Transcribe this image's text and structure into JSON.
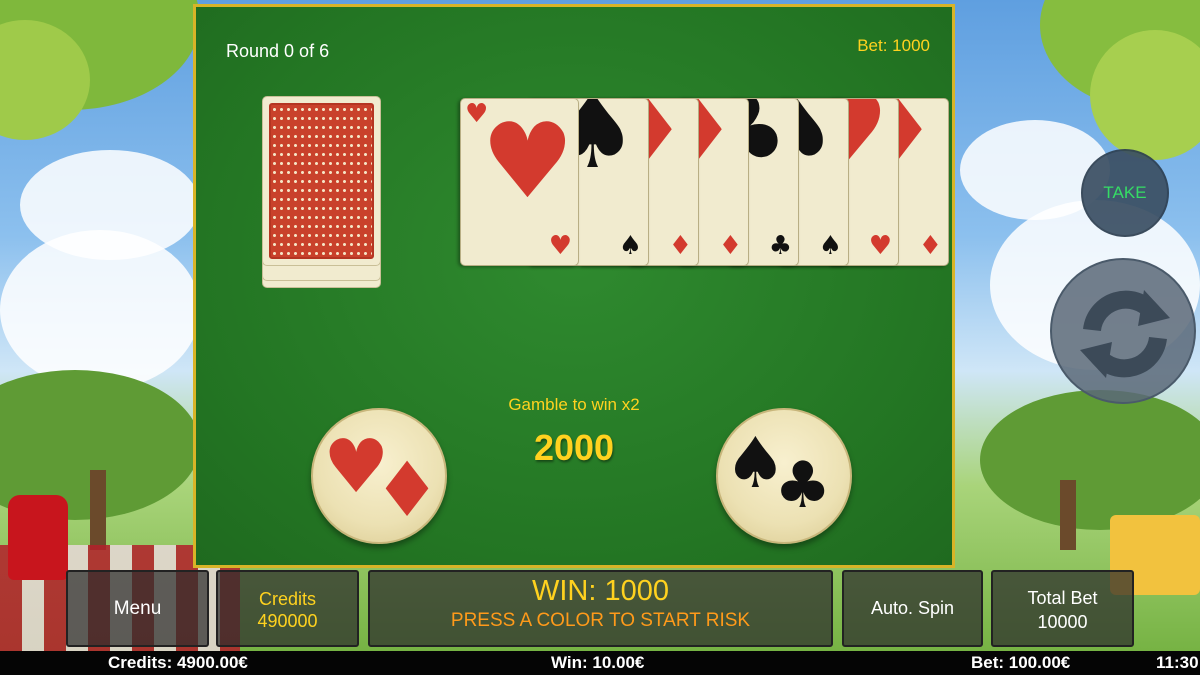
{
  "table": {
    "round": "Round 0 of 6",
    "bet": "Bet: 1000",
    "gamble_label": "Gamble to win x2",
    "gamble_amount": "2000"
  },
  "history_cards": [
    {
      "suit": "hearts",
      "glyph": "♥",
      "color": "#d33a2e"
    },
    {
      "suit": "spades",
      "glyph": "♠",
      "color": "#111111"
    },
    {
      "suit": "diamonds",
      "glyph": "♦",
      "color": "#d33a2e"
    },
    {
      "suit": "diamonds",
      "glyph": "♦",
      "color": "#d33a2e"
    },
    {
      "suit": "clubs",
      "glyph": "♣",
      "color": "#111111"
    },
    {
      "suit": "spades",
      "glyph": "♠",
      "color": "#111111"
    },
    {
      "suit": "hearts",
      "glyph": "♥",
      "color": "#d33a2e"
    },
    {
      "suit": "diamonds",
      "glyph": "♦",
      "color": "#d33a2e"
    }
  ],
  "buttons": {
    "take": "TAKE",
    "red_choice": {
      "glyphs": [
        "♥",
        "♦"
      ],
      "color": "#d33a2e"
    },
    "black_choice": {
      "glyphs": [
        "♠",
        "♣"
      ],
      "color": "#111111"
    }
  },
  "bottom_panel": {
    "menu": "Menu",
    "credits_label": "Credits",
    "credits_value": "490000",
    "win": "WIN: 1000",
    "message": "PRESS A COLOR TO START RISK",
    "auto_spin": "Auto. Spin",
    "total_bet_label": "Total Bet",
    "total_bet_value": "10000"
  },
  "status_bar": {
    "credits": "Credits: 4900.00€",
    "win": "Win: 10.00€",
    "bet": "Bet: 100.00€",
    "time": "11:30"
  },
  "colors": {
    "table_green": "#237523",
    "table_border": "#d8b427",
    "accent_yellow": "#ffd21f",
    "take_green": "#2fe05a",
    "message_orange": "#ff9a1a"
  }
}
